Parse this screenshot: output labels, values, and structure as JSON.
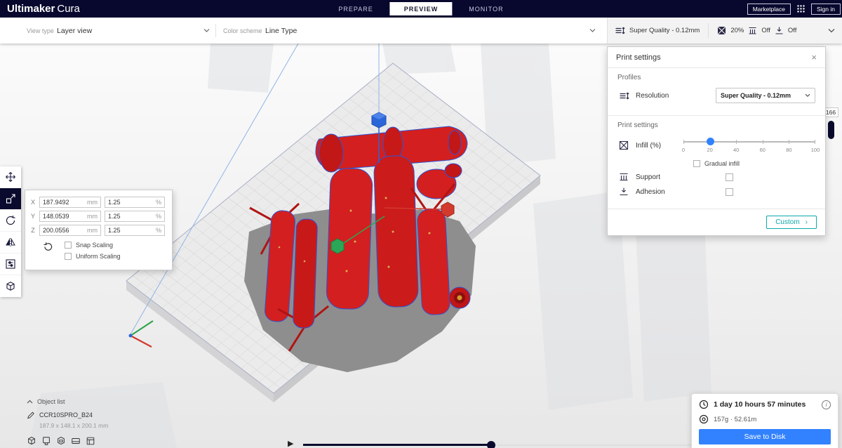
{
  "colors": {
    "topbar": "#08082e",
    "accent_blue": "#3282ff",
    "teal": "#0ca9ab",
    "model_red": "#d31f1f"
  },
  "icons": {
    "play": "▶",
    "close": "×",
    "chevron_right": "›",
    "info": "i"
  },
  "header": {
    "logo_primary": "Ultimaker",
    "logo_secondary": "Cura",
    "tabs": [
      {
        "label": "PREPARE"
      },
      {
        "label": "PREVIEW"
      },
      {
        "label": "MONITOR"
      }
    ],
    "marketplace_label": "Marketplace",
    "signin_label": "Sign in"
  },
  "viewbar": {
    "view_type_label": "View type",
    "view_type_value": "Layer view",
    "color_scheme_label": "Color scheme",
    "color_scheme_value": "Line Type",
    "summary": {
      "profile": "Super Quality - 0.12mm",
      "infill": "20%",
      "support": "Off",
      "adhesion": "Off"
    }
  },
  "print_settings": {
    "title": "Print settings",
    "profiles_label": "Profiles",
    "resolution_label": "Resolution",
    "resolution_value": "Super Quality - 0.12mm",
    "section_label": "Print settings",
    "infill_label": "Infill (%)",
    "infill_value": 20,
    "infill_ticks": [
      "0",
      "20",
      "40",
      "60",
      "80",
      "100"
    ],
    "gradual_infill_label": "Gradual infill",
    "support_label": "Support",
    "adhesion_label": "Adhesion",
    "custom_label": "Custom"
  },
  "scale_panel": {
    "rows": [
      {
        "axis": "X",
        "value": "187.9492",
        "unit": "mm",
        "percent": "1.25",
        "pct_suffix": "%"
      },
      {
        "axis": "Y",
        "value": "148.0539",
        "unit": "mm",
        "percent": "1.25",
        "pct_suffix": "%"
      },
      {
        "axis": "Z",
        "value": "200.0556",
        "unit": "mm",
        "percent": "1.25",
        "pct_suffix": "%"
      }
    ],
    "snap_label": "Snap Scaling",
    "uniform_label": "Uniform Scaling"
  },
  "object_list": {
    "toggle_label": "Object list",
    "model_name": "CCR10SPRO_B24",
    "dimensions": "187.9 x 148.1 x 200.1 mm"
  },
  "layer_slider": {
    "value": "166"
  },
  "job_info": {
    "time": "1 day 10 hours 57 minutes",
    "material": "157g · 52.61m",
    "save_button": "Save to Disk"
  }
}
